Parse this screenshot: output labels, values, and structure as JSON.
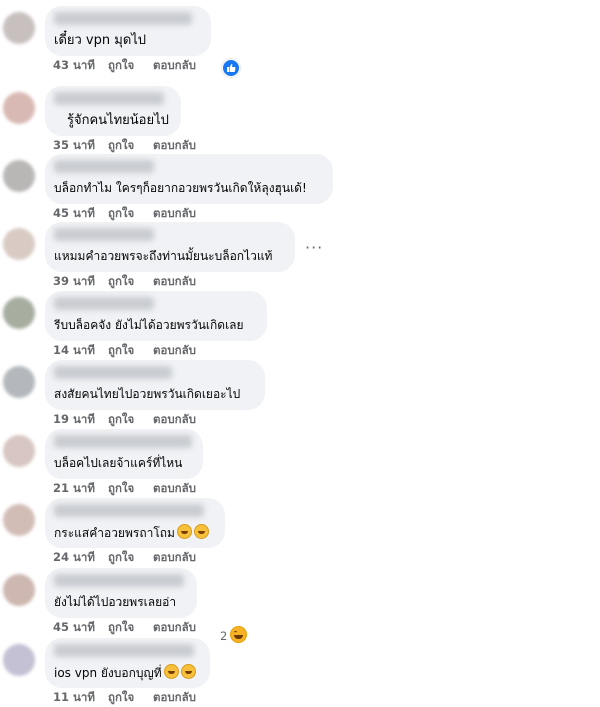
{
  "actions": {
    "like": "ถูกใจ",
    "reply": "ตอบกลับ"
  },
  "colors": {
    "bubble": "#f0f2f5",
    "meta": "#65676b",
    "like_blue": "#1877f2"
  },
  "comments": [
    {
      "text": "เดี๋ยว vpn มุดไป",
      "time": "43 นาที",
      "reaction": "like"
    },
    {
      "text": "รู้จักคนไทยน้อยไป",
      "time": "35 นาที"
    },
    {
      "text": "บล็อกทำไม ใครๆก็อยากอวยพรวันเกิดให้ลุงฮุนเด้!",
      "time": "45 นาที"
    },
    {
      "text": "แหมมคำอวยพรจะถึงท่านมั้ยนะบล็อกไวแท้",
      "time": "39 นาที"
    },
    {
      "text": "รีบบล็อคจัง ยังไม่ได้อวยพรวันเกิดเลย",
      "time": "14 นาที"
    },
    {
      "text": "สงสัยคนไทยไปอวยพรวันเกิดเยอะไป",
      "time": "19 นาที"
    },
    {
      "text": "บล็อคไปเลยจ้าแคร์ที่ไหน",
      "time": "21 นาที"
    },
    {
      "text": "กระแสคำอวยพรถาโถม",
      "time": "24 นาที",
      "emoji": "rofl-emoji"
    },
    {
      "text": "ยังไม่ได้ไปอวยพรเลยอ่า",
      "time": "45 นาที",
      "reaction_count": "2",
      "reaction": "haha"
    },
    {
      "text": "ios vpn ยังบอกบุญที่",
      "time": "11 นาที",
      "emoji": "rofl-emoji"
    }
  ]
}
